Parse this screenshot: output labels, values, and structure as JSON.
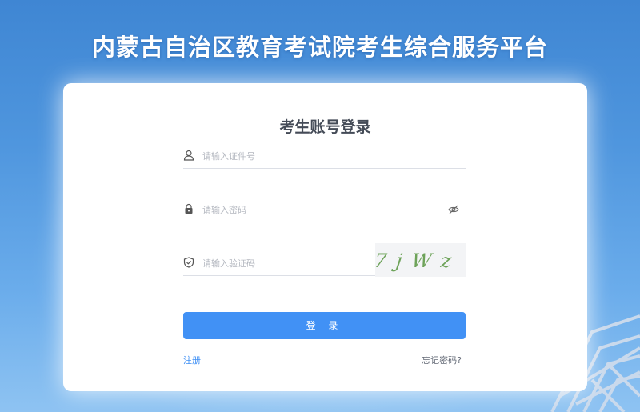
{
  "header": {
    "title": "内蒙古自治区教育考试院考生综合服务平台"
  },
  "login": {
    "title": "考生账号登录",
    "id_field": {
      "placeholder": "请输入证件号",
      "value": ""
    },
    "password_field": {
      "placeholder": "请输入密码",
      "value": ""
    },
    "captcha_field": {
      "placeholder": "请输入验证码",
      "value": ""
    },
    "captcha_image_text": "7jWz",
    "submit_label": "登 录",
    "register_link": "注册",
    "forgot_link": "忘记密码?"
  },
  "colors": {
    "accent": "#4191f5",
    "background_top": "#3f86d3",
    "background_bottom": "#8ec3f2"
  },
  "icons": {
    "id_field": "user-icon",
    "password_field": "lock-icon",
    "password_toggle": "eye-slash-icon",
    "captcha_field": "shield-check-icon"
  }
}
